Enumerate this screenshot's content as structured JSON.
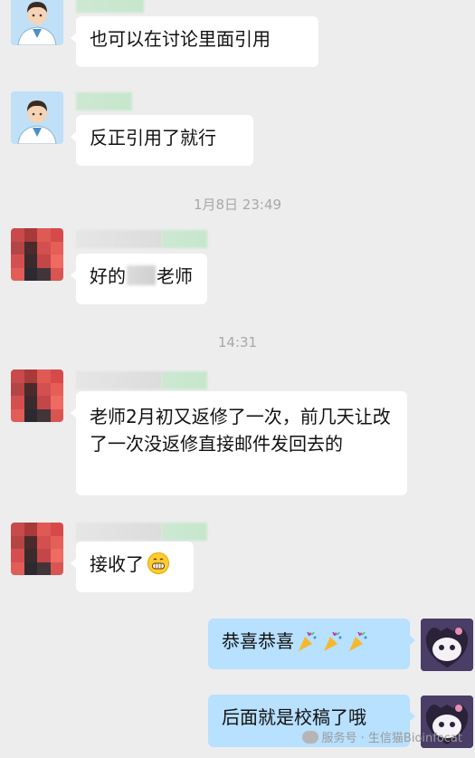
{
  "messages": [
    {
      "text": "也可以在讨论里面引用"
    },
    {
      "text": "反正引用了就行"
    },
    {
      "text_before": "好的",
      "text_after": "老师"
    },
    {
      "text": "老师2月初又返修了一次，前几天让改了一次没返修直接邮件发回去的"
    },
    {
      "text": "接收了",
      "emoji": "grinning-face-emoji"
    },
    {
      "text": "恭喜恭喜",
      "emoji": "party-popper-emoji"
    },
    {
      "text": "后面就是校稿了哦"
    }
  ],
  "timestamps": [
    "1月8日 23:49",
    "14:31"
  ],
  "watermark": {
    "icon": "wechat-icon",
    "text": "服务号 · 生信猫Bioinfocat"
  },
  "colors": {
    "background": "#ededed",
    "incoming_bubble": "#ffffff",
    "outgoing_bubble": "#b8e0ff"
  }
}
